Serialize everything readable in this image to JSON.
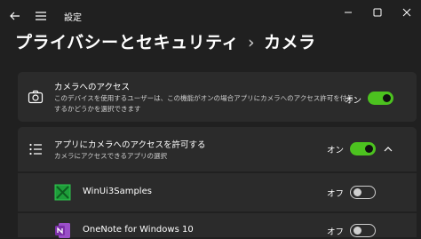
{
  "window": {
    "title": "設定",
    "controls": [
      "minimize-icon",
      "maximize-icon",
      "close-icon"
    ]
  },
  "header": {
    "breadcrumb_parent": "プライバシーとセキュリティ",
    "breadcrumb_separator": "›",
    "breadcrumb_current": "カメラ"
  },
  "camera_access": {
    "icon": "camera-icon",
    "title": "カメラへのアクセス",
    "description": "このデバイスを使用するユーザーは、この機能がオンの場合アプリにカメラへのアクセス許可を付与するかどうかを選択できます",
    "state_label": "オン",
    "enabled": true
  },
  "app_access": {
    "icon": "list-icon",
    "title": "アプリにカメラへのアクセスを許可する",
    "description": "カメラにアクセスできるアプリの選択",
    "state_label": "オン",
    "enabled": true,
    "expanded": true
  },
  "apps": [
    {
      "name": "WinUi3Samples",
      "icon": "winui3-app-icon",
      "state_label": "オフ",
      "enabled": false
    },
    {
      "name": "OneNote for Windows 10",
      "icon": "onenote-icon",
      "state_label": "オフ",
      "enabled": false
    }
  ],
  "colors": {
    "background": "#202020",
    "card": "#2b2b2b",
    "accent_toggle_on": "#4cc21f",
    "winui_green": "#1e9e3a",
    "onenote_purple": "#7b2fa8"
  }
}
